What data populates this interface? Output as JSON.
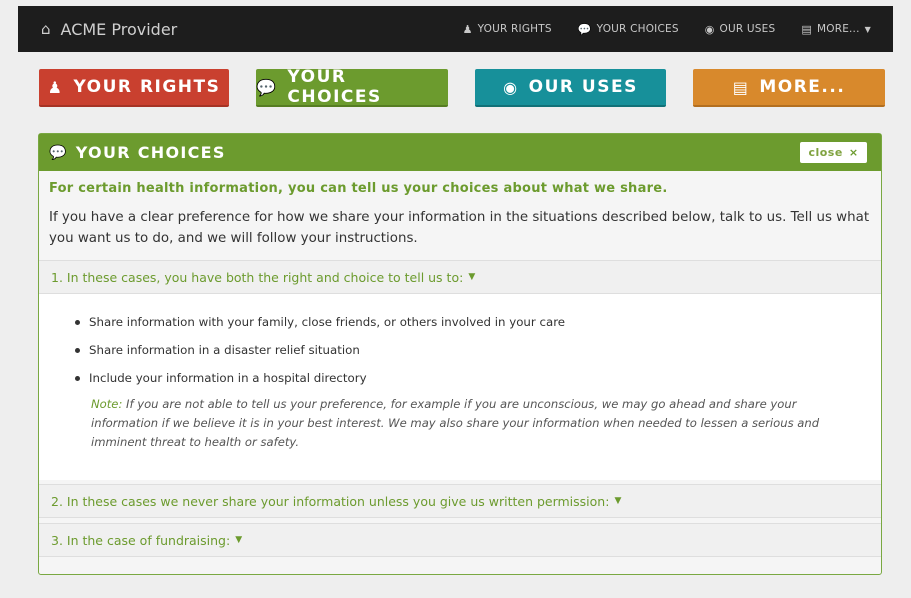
{
  "navbar": {
    "brand": "ACME Provider",
    "brand_icon": "home-icon",
    "links": [
      {
        "label": "YOUR RIGHTS",
        "icon": "user-icon"
      },
      {
        "label": "YOUR CHOICES",
        "icon": "comments-icon"
      },
      {
        "label": "OUR USES",
        "icon": "eye-icon"
      },
      {
        "label": "MORE...",
        "icon": "list-icon"
      }
    ]
  },
  "buttons": {
    "rights": "YOUR RIGHTS",
    "choices": "YOUR CHOICES",
    "uses": "OUR USES",
    "more": "MORE..."
  },
  "panel": {
    "title": "YOUR CHOICES",
    "close_label": "close",
    "close_symbol": "×",
    "lead": "For certain health information, you can tell us your choices about what we share.",
    "intro": "If you have a clear preference for how we share your information in the situations described below, talk to us. Tell us what you want us to do, and we will follow your instructions.",
    "sections": [
      {
        "title": "1. In these cases, you have both the right and choice to tell us to:"
      },
      {
        "title": "2. In these cases we never share your information unless you give us written permission:"
      },
      {
        "title": "3. In the case of fundraising:"
      }
    ],
    "items": [
      "Share information with your family, close friends, or others involved in your care",
      "Share information in a disaster relief situation",
      "Include your information in a hospital directory"
    ],
    "note_label": "Note:",
    "note_text": " If you are not able to tell us your preference, for example if you are unconscious, we may go ahead and share your information if we believe it is in your best interest. We may also share your information when needed to lessen a serious and imminent threat to health or safety."
  },
  "colors": {
    "rights": "#c9402f",
    "choices": "#6c9b2e",
    "uses": "#17909a",
    "more": "#d8892c",
    "navbar": "#1d1d1d"
  }
}
